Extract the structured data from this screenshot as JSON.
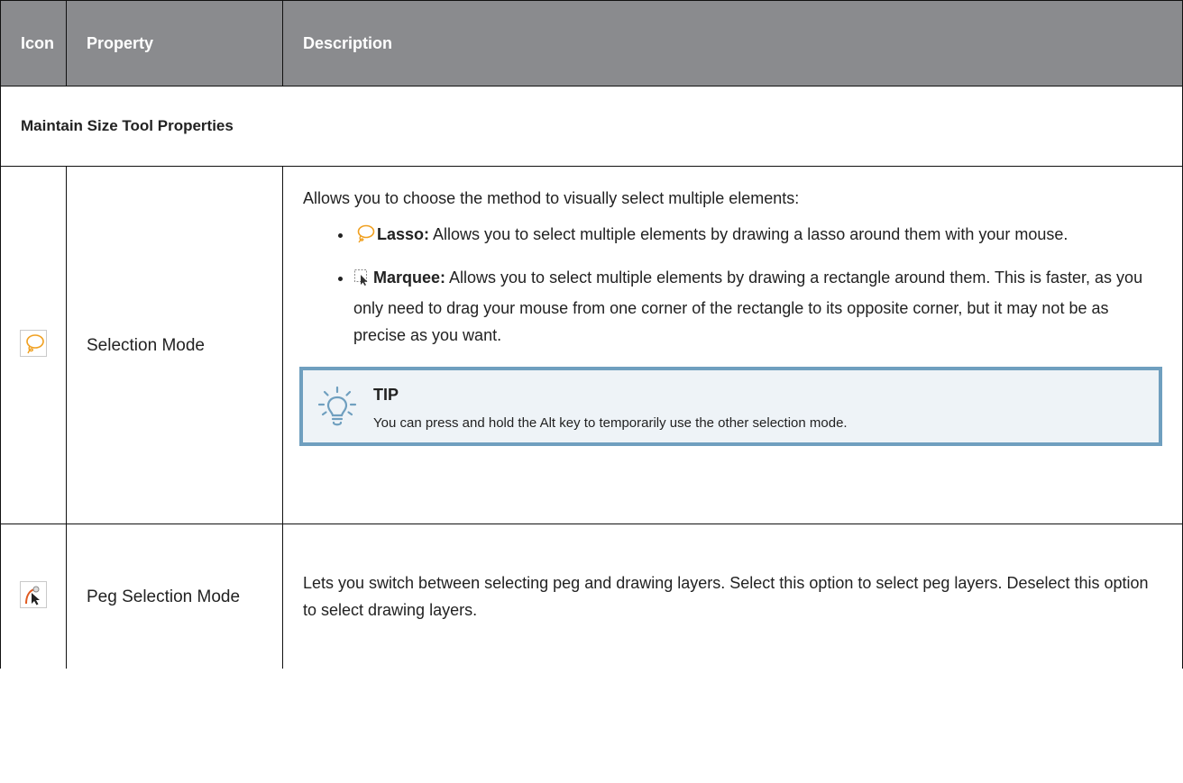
{
  "header": {
    "icon": "Icon",
    "property": "Property",
    "description": "Description"
  },
  "section_title": "Maintain Size Tool Properties",
  "rows": [
    {
      "icon": "lasso-icon",
      "property": "Selection Mode",
      "intro": "Allows you to choose the method to visually select multiple elements:",
      "bullets": [
        {
          "icon": "lasso-icon",
          "term": "Lasso:",
          "text": " Allows you to select multiple elements by drawing a lasso around them with your mouse."
        },
        {
          "icon": "marquee-icon",
          "term": "Marquee:",
          "text": " Allows you to select multiple elements by drawing a rectangle around them. This is faster, as you only need to drag your mouse from one corner of the rectangle to its opposite corner, but it may not be as precise as you want."
        }
      ],
      "tip": {
        "icon": "lightbulb-icon",
        "title": "TIP",
        "text": "You can press and hold the Alt key to temporarily use the other selection mode."
      }
    },
    {
      "icon": "peg-selection-icon",
      "property": "Peg Selection Mode",
      "description": "Lets you switch between selecting peg and drawing layers. Select this option to select peg layers. Deselect this option to select drawing layers."
    }
  ],
  "colors": {
    "header_bg": "#8a8b8e",
    "tip_border": "#6f9fbf",
    "tip_bg": "#eef3f7",
    "lasso": "#f0a020"
  }
}
